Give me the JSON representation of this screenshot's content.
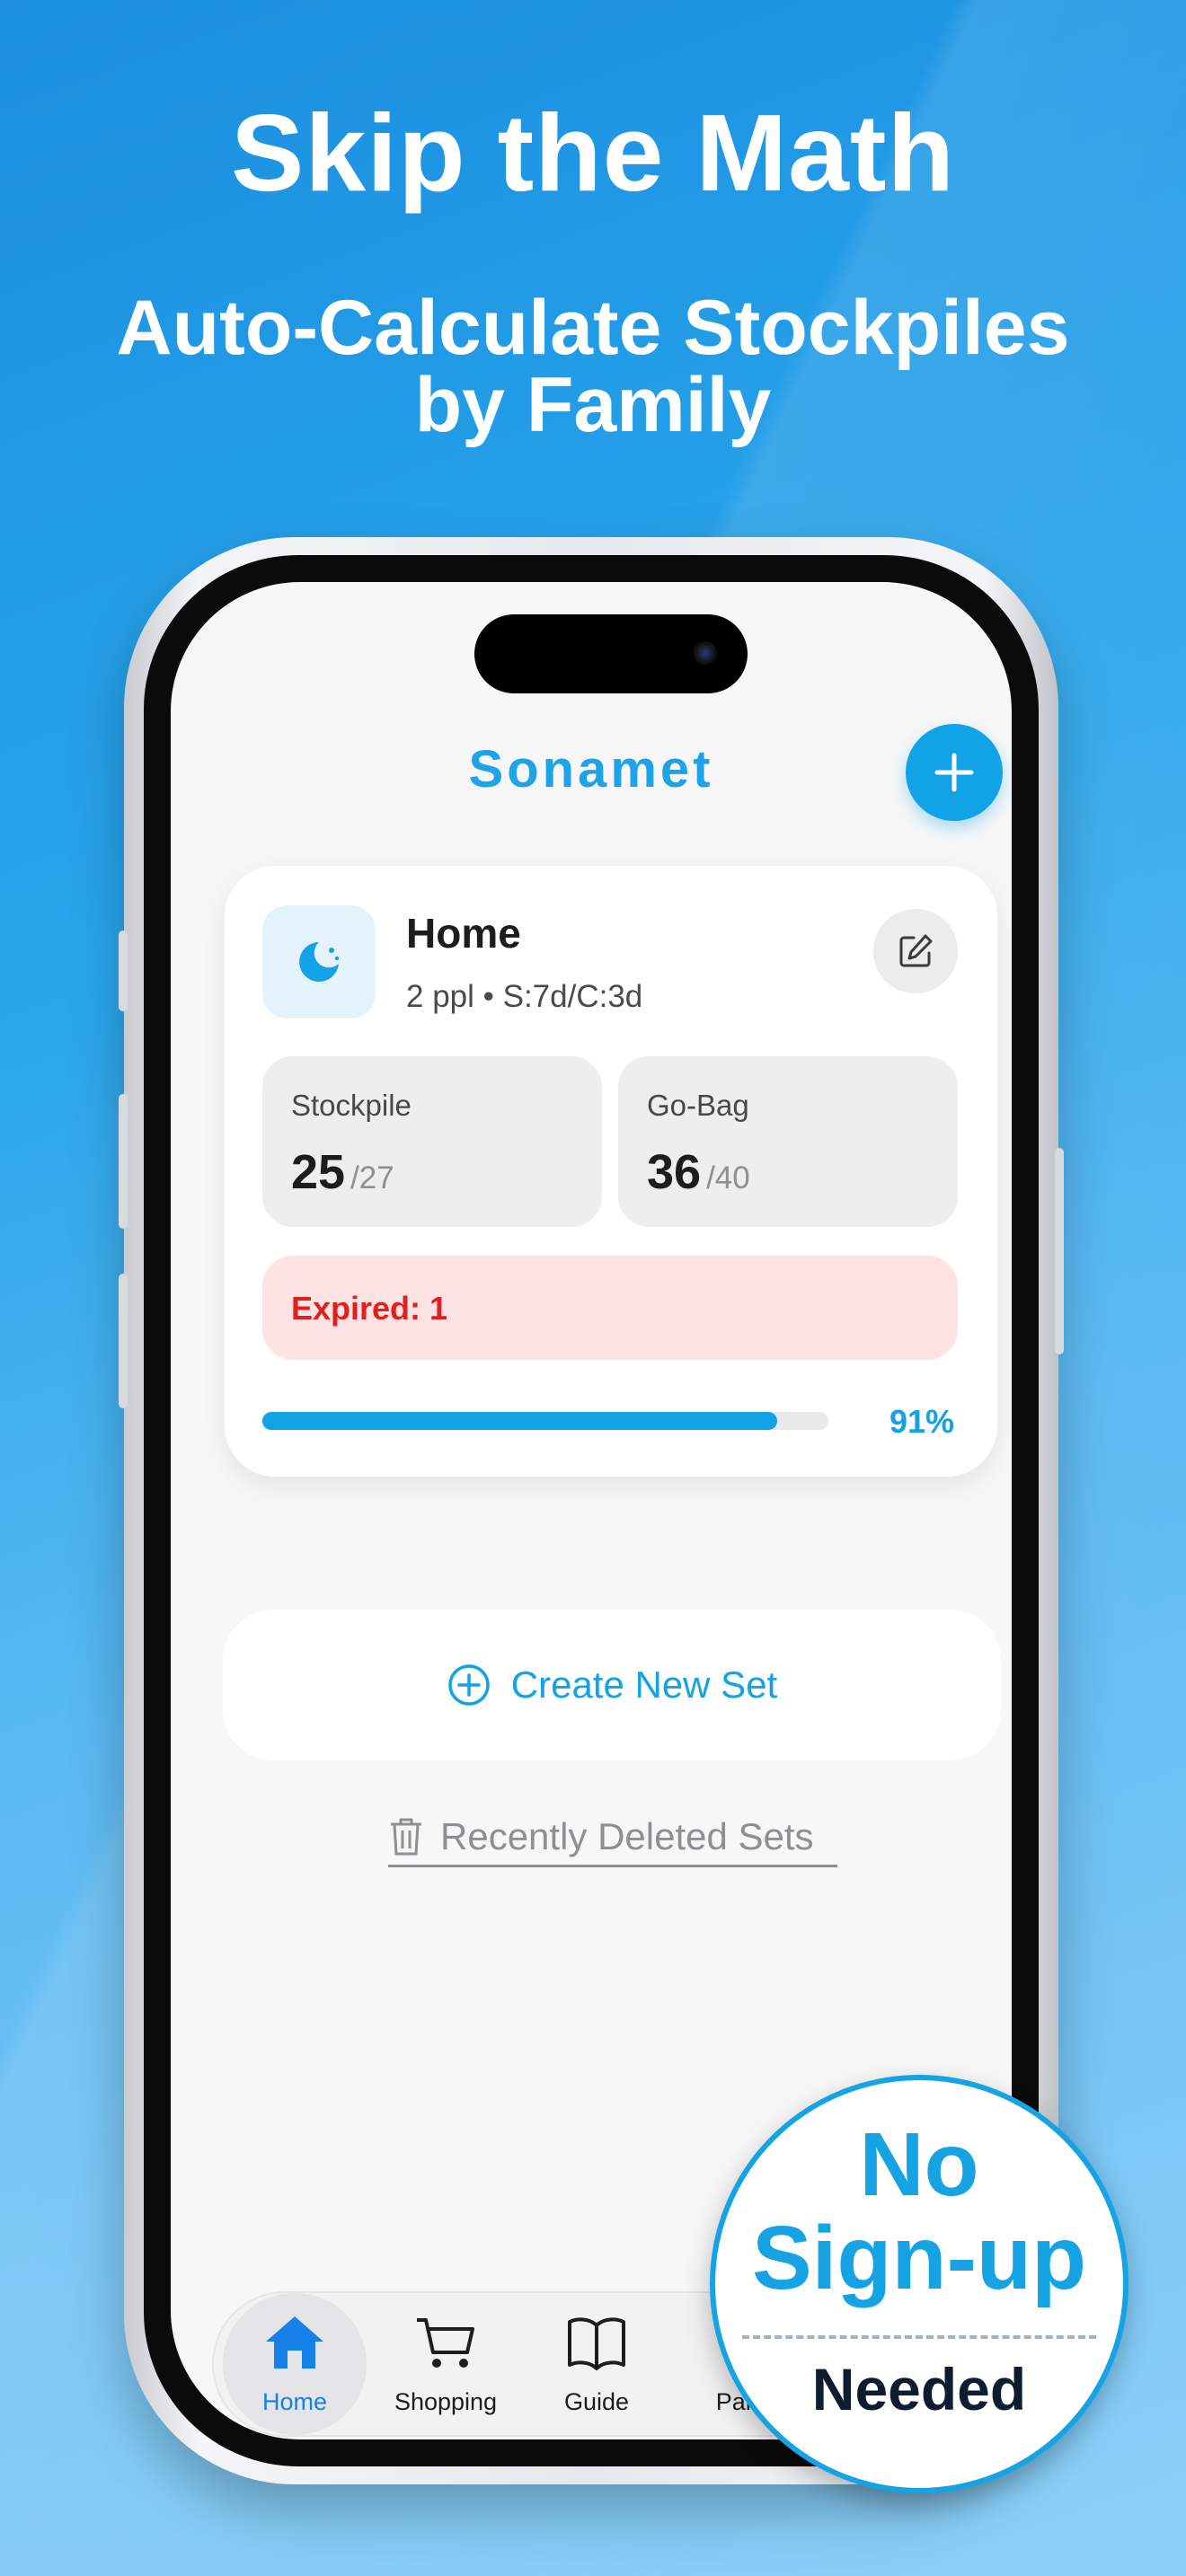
{
  "promo": {
    "headline": "Skip the Math",
    "subheadline_line1": "Auto-Calculate Stockpiles",
    "subheadline_line2": "by Family"
  },
  "app": {
    "title": "Sonamet",
    "add_button_icon": "plus-icon"
  },
  "set_card": {
    "icon": "moon-icon",
    "name": "Home",
    "meta": "2 ppl • S:7d/C:3d",
    "edit_icon": "edit-icon",
    "stockpile": {
      "label": "Stockpile",
      "value": "25",
      "total": "/27"
    },
    "gobag": {
      "label": "Go-Bag",
      "value": "36",
      "total": "/40"
    },
    "expired_text": "Expired: 1",
    "progress_fraction": 0.91,
    "progress_text": "91%"
  },
  "create_set": {
    "label": "Create New Set",
    "icon": "plus-circle-icon"
  },
  "recently_deleted": {
    "label": "Recently Deleted Sets",
    "icon": "trash-icon"
  },
  "tabs": [
    {
      "label": "Home",
      "icon": "home-icon",
      "active": true
    },
    {
      "label": "Shopping",
      "icon": "cart-icon",
      "active": false
    },
    {
      "label": "Guide",
      "icon": "book-icon",
      "active": false
    },
    {
      "label": "Pamp",
      "icon": "pamphlet-icon",
      "active": false
    }
  ],
  "badge": {
    "line1": "No",
    "line2": "Sign-up",
    "line3": "Needed"
  },
  "colors": {
    "accent": "#12a2e6",
    "expired_bg": "#fde3e3",
    "expired_text": "#e0201f",
    "tab_active": "#1580e8"
  }
}
